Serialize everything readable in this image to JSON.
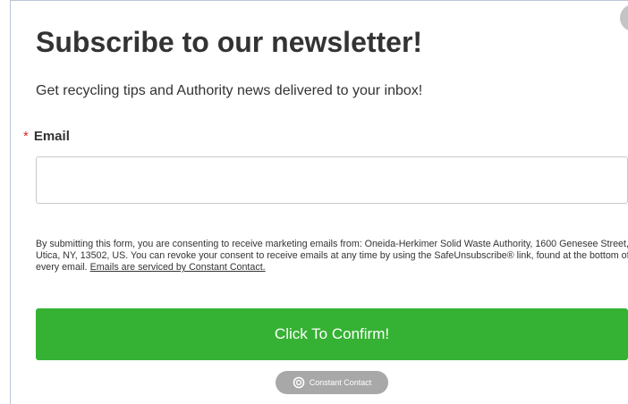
{
  "modal": {
    "title": "Subscribe to our newsletter!",
    "subtitle": "Get recycling tips and Authority news delivered to your inbox!",
    "close_icon": "close-icon"
  },
  "form": {
    "required_marker": "*",
    "email_label": "Email",
    "email_value": "",
    "email_placeholder": "",
    "consent_text": "By submitting this form, you are consenting to receive marketing emails from: Oneida-Herkimer Solid Waste Authority, 1600 Genesee Street, Utica, NY, 13502, US. You can revoke your consent to receive emails at any time by using the SafeUnsubscribe® link, found at the bottom of every email.",
    "consent_link": "Emails are serviced by Constant Contact.",
    "submit_label": "Click To Confirm!"
  },
  "badge": {
    "label": "Constant Contact",
    "icon": "constant-contact-logo-icon"
  },
  "colors": {
    "button_green": "#35b233",
    "required_red": "#d82b2b",
    "close_gray": "#c4c4c4",
    "badge_gray": "#a8a8a8",
    "text_dark": "#333333"
  }
}
